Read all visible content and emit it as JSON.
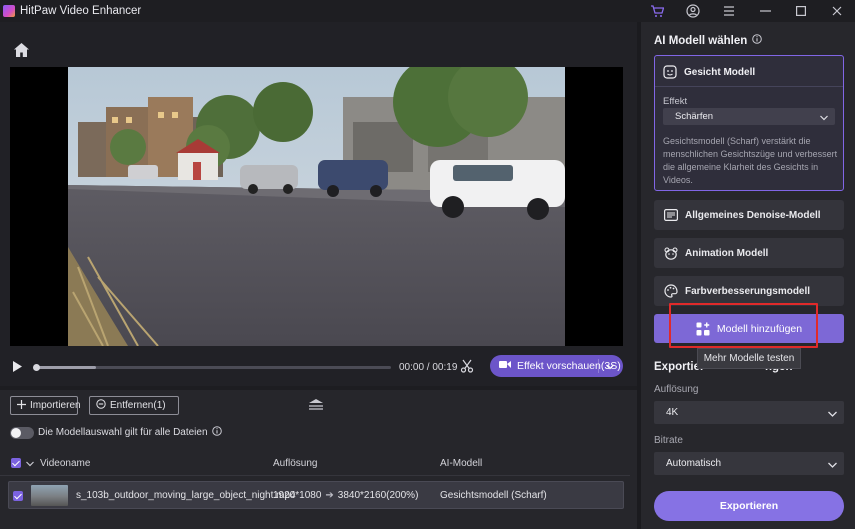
{
  "app": {
    "title": "HitPaw Video Enhancer"
  },
  "titlebar": {
    "icons": [
      "cart-icon",
      "user-icon",
      "menu-icon",
      "minimize-icon",
      "maximize-icon",
      "close-icon"
    ]
  },
  "player": {
    "time": "00:00 / 00:19",
    "progress": 0.17,
    "preview_button": "Effekt vorschauen(3S)"
  },
  "files": {
    "import_label": "Importieren",
    "remove_label": "Entfernen(1)",
    "apply_all_label": "Die Modellauswahl gilt für alle Dateien",
    "columns": {
      "video": "Videoname",
      "resolution": "Auflösung",
      "model": "AI-Modell"
    },
    "rows": [
      {
        "name": "s_103b_outdoor_moving_large_object_night.mp4",
        "resolution_from": "1920*1080",
        "resolution_to": "3840*2160(200%)",
        "model": "Gesichtsmodell (Scharf)"
      }
    ]
  },
  "ai_panel": {
    "title": "AI Modell wählen",
    "selected_model": {
      "name": "Gesicht Modell",
      "effect_label": "Effekt",
      "effect_value": "Schärfen",
      "description": "Gesichtsmodell (Scharf) verstärkt die menschlichen Gesichtszüge und verbessert die allgemeine Klarheit des Gesichts in Videos."
    },
    "models": [
      {
        "name": "Allgemeines Denoise-Modell",
        "icon": "denoise-icon"
      },
      {
        "name": "Animation Modell",
        "icon": "animation-bear-icon"
      },
      {
        "name": "Farbverbesserungsmodell",
        "icon": "palette-icon"
      }
    ],
    "add_model_label": "Modell hinzufügen",
    "tooltip": "Mehr Modelle testen",
    "accent": "#8166e6"
  },
  "export": {
    "title_start": "Exportier",
    "title_end": "ngen",
    "resolution_label": "Auflösung",
    "resolution_value": "4K",
    "bitrate_label": "Bitrate",
    "bitrate_value": "Automatisch",
    "export_button": "Exportieren"
  }
}
